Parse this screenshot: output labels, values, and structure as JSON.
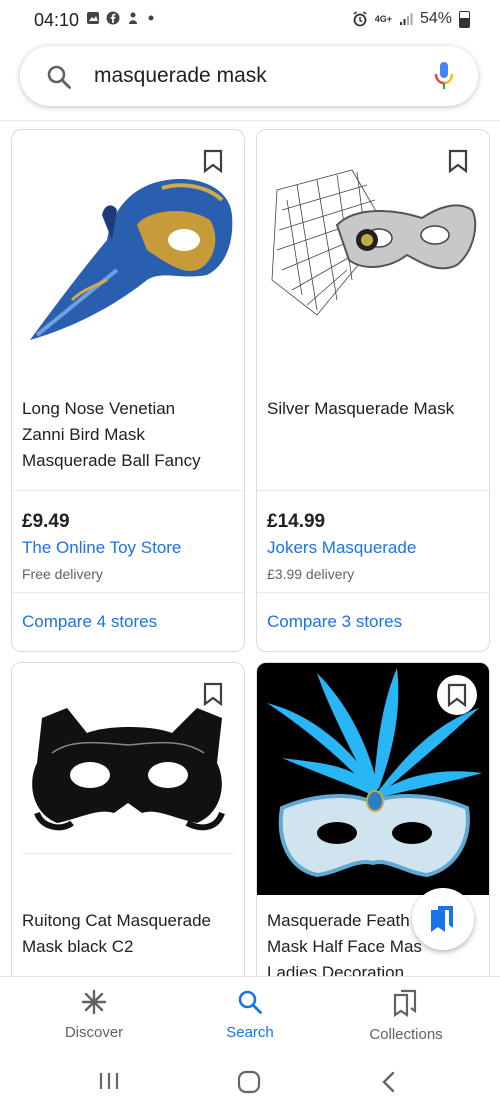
{
  "status_bar": {
    "time": "04:10",
    "network": "4G+",
    "battery": "54%"
  },
  "search": {
    "query": "masquerade mask"
  },
  "products": [
    {
      "title_lines": [
        "Long Nose Venetian",
        "Zanni Bird Mask",
        "Masquerade Ball Fancy"
      ],
      "price": "£9.49",
      "store": "The Online Toy Store",
      "delivery": "Free delivery",
      "compare": "Compare 4 stores"
    },
    {
      "title_lines": [
        "Silver Masquerade Mask"
      ],
      "price": "£14.99",
      "store": "Jokers Masquerade",
      "delivery": "£3.99 delivery",
      "compare": "Compare 3 stores"
    },
    {
      "title_lines": [
        "Ruitong Cat Masquerade",
        "Mask black C2"
      ]
    },
    {
      "title_lines": [
        "Masquerade Feath",
        "Mask Half Face Mas",
        "Ladies Decoration"
      ]
    }
  ],
  "bottom_nav": [
    {
      "label": "Discover",
      "icon": "asterisk-icon",
      "active": false
    },
    {
      "label": "Search",
      "icon": "search-icon",
      "active": true
    },
    {
      "label": "Collections",
      "icon": "collections-icon",
      "active": false
    }
  ],
  "colors": {
    "accent": "#1a73e8",
    "text": "#202124",
    "muted": "#5f6368"
  }
}
